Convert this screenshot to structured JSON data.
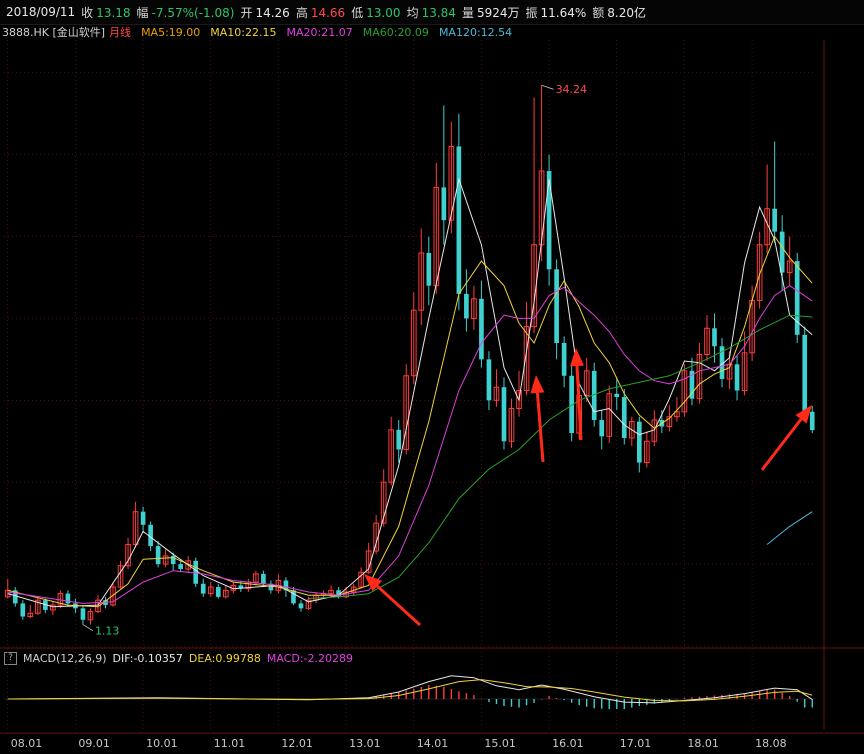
{
  "header": {
    "date": "2018/09/11",
    "close_label": "收",
    "close": "13.18",
    "change_label": "幅",
    "change": "-7.57%(-1.08)",
    "open_label": "开",
    "open": "14.26",
    "high_label": "高",
    "high": "14.66",
    "low_label": "低",
    "low": "13.00",
    "avg_label": "均",
    "avg": "13.84",
    "volume_label": "量",
    "volume": "5924万",
    "amplitude_label": "振",
    "amplitude": "11.64%",
    "amount_label": "额",
    "amount": "8.20亿"
  },
  "ma_legend": {
    "code": "3888.HK [金山软件]",
    "period": "月线",
    "ma5": "MA5:19.00",
    "ma10": "MA10:22.15",
    "ma20": "MA20:21.07",
    "ma60": "MA60:20.09",
    "ma120": "MA120:12.54"
  },
  "macd_legend": {
    "help": "?",
    "name": "MACD(12,26,9)",
    "dif": "DIF:-0.10357",
    "dea": "DEA:0.99788",
    "macd": "MACD:-2.20289"
  },
  "annotations": {
    "high_label": "34.24",
    "low_label": "1.13"
  },
  "colors": {
    "up": "#ff3b3b",
    "down": "#3fd0d0",
    "ma5": "#e8e8e8",
    "ma10": "#f0d23a",
    "ma20": "#e040e0",
    "ma60": "#2ca02c",
    "ma120": "#4fb8d8",
    "arrow": "#ff2a1a",
    "grid": "#7a1414"
  },
  "chart_data": {
    "type": "candlestick",
    "x_ticks": [
      "08.01",
      "09.01",
      "10.01",
      "11.01",
      "12.01",
      "13.01",
      "14.01",
      "15.01",
      "16.01",
      "17.01",
      "18.01",
      "18.08"
    ],
    "price_range": [
      0,
      37
    ],
    "candles": [
      [
        3.0,
        3.4,
        4.1,
        2.9
      ],
      [
        3.4,
        2.6,
        3.6,
        2.4
      ],
      [
        2.6,
        1.8,
        2.8,
        1.6
      ],
      [
        1.8,
        2.0,
        2.5,
        1.7
      ],
      [
        2.0,
        2.8,
        3.0,
        1.9
      ],
      [
        2.8,
        2.2,
        2.9,
        2.0
      ],
      [
        2.2,
        2.5,
        2.7,
        1.9
      ],
      [
        2.5,
        3.2,
        3.4,
        2.3
      ],
      [
        3.2,
        2.6,
        3.4,
        2.4
      ],
      [
        2.6,
        2.3,
        2.9,
        2.0
      ],
      [
        2.3,
        1.6,
        2.5,
        1.3
      ],
      [
        1.6,
        2.1,
        2.3,
        1.3
      ],
      [
        2.1,
        2.8,
        3.1,
        2.0
      ],
      [
        2.8,
        2.5,
        3.0,
        2.3
      ],
      [
        2.5,
        3.6,
        3.9,
        2.4
      ],
      [
        3.6,
        4.9,
        5.2,
        3.5
      ],
      [
        4.9,
        6.2,
        6.6,
        4.7
      ],
      [
        6.2,
        8.2,
        8.8,
        6.0
      ],
      [
        8.2,
        7.4,
        8.5,
        6.9
      ],
      [
        7.4,
        6.1,
        7.6,
        5.8
      ],
      [
        6.1,
        5.0,
        6.4,
        4.8
      ],
      [
        5.0,
        5.5,
        5.9,
        4.8
      ],
      [
        5.5,
        5.0,
        5.7,
        4.6
      ],
      [
        5.0,
        4.7,
        5.3,
        4.5
      ],
      [
        4.7,
        5.2,
        5.5,
        4.5
      ],
      [
        5.2,
        3.8,
        5.4,
        3.6
      ],
      [
        3.8,
        3.2,
        4.1,
        3.0
      ],
      [
        3.2,
        3.6,
        3.9,
        3.0
      ],
      [
        3.6,
        3.0,
        3.8,
        2.9
      ],
      [
        3.0,
        3.4,
        3.7,
        2.9
      ],
      [
        3.4,
        3.7,
        3.9,
        3.2
      ],
      [
        3.7,
        3.5,
        4.0,
        3.3
      ],
      [
        3.5,
        3.9,
        4.1,
        3.3
      ],
      [
        3.9,
        4.4,
        4.6,
        3.7
      ],
      [
        4.4,
        3.8,
        4.6,
        3.6
      ],
      [
        3.8,
        3.4,
        4.0,
        3.2
      ],
      [
        3.4,
        4.0,
        4.4,
        3.2
      ],
      [
        4.0,
        3.4,
        4.2,
        3.0
      ],
      [
        3.4,
        2.6,
        3.6,
        2.5
      ],
      [
        2.6,
        2.3,
        2.8,
        2.1
      ],
      [
        2.3,
        2.8,
        3.0,
        2.2
      ],
      [
        2.8,
        3.1,
        3.3,
        2.6
      ],
      [
        3.1,
        3.2,
        3.4,
        2.9
      ],
      [
        3.2,
        3.4,
        3.7,
        3.0
      ],
      [
        3.4,
        3.0,
        3.6,
        2.9
      ],
      [
        3.0,
        3.3,
        3.6,
        2.9
      ],
      [
        3.3,
        3.6,
        3.8,
        3.1
      ],
      [
        3.6,
        4.5,
        4.8,
        3.5
      ],
      [
        4.5,
        5.8,
        6.3,
        4.4
      ],
      [
        5.8,
        7.5,
        8.0,
        5.6
      ],
      [
        7.5,
        10.0,
        10.8,
        7.3
      ],
      [
        10.0,
        13.2,
        14.0,
        9.8
      ],
      [
        13.2,
        12.0,
        13.8,
        11.2
      ],
      [
        12.0,
        16.5,
        17.2,
        11.7
      ],
      [
        16.5,
        20.5,
        21.6,
        16.0
      ],
      [
        20.5,
        24.0,
        25.5,
        19.6
      ],
      [
        24.0,
        22.0,
        25.0,
        20.8
      ],
      [
        22.0,
        28.0,
        29.5,
        21.5
      ],
      [
        28.0,
        26.0,
        33.0,
        24.5
      ],
      [
        26.0,
        30.5,
        32.0,
        25.2
      ],
      [
        30.5,
        21.5,
        32.5,
        20.5
      ],
      [
        21.5,
        20.0,
        23.0,
        19.2
      ],
      [
        20.0,
        21.2,
        22.0,
        19.3
      ],
      [
        21.2,
        17.5,
        22.3,
        17.0
      ],
      [
        17.5,
        15.0,
        18.0,
        14.4
      ],
      [
        15.0,
        15.8,
        16.9,
        14.6
      ],
      [
        15.8,
        12.5,
        16.4,
        12.0
      ],
      [
        12.5,
        14.5,
        15.1,
        12.1
      ],
      [
        14.5,
        15.6,
        16.8,
        14.0
      ],
      [
        15.6,
        19.5,
        21.0,
        15.3
      ],
      [
        19.5,
        24.5,
        33.5,
        19.1
      ],
      [
        24.5,
        29.0,
        34.24,
        23.5
      ],
      [
        29.0,
        23.0,
        30.0,
        22.0
      ],
      [
        23.0,
        18.5,
        23.6,
        17.5
      ],
      [
        18.5,
        16.5,
        18.9,
        15.8
      ],
      [
        16.5,
        13.0,
        17.2,
        12.5
      ],
      [
        13.0,
        15.3,
        15.8,
        12.6
      ],
      [
        15.3,
        16.8,
        17.6,
        14.9
      ],
      [
        16.8,
        13.8,
        17.3,
        13.4
      ],
      [
        13.8,
        12.8,
        14.4,
        12.0
      ],
      [
        12.8,
        15.4,
        15.9,
        12.4
      ],
      [
        15.4,
        15.2,
        16.4,
        14.4
      ],
      [
        15.2,
        12.7,
        15.7,
        12.3
      ],
      [
        12.7,
        13.7,
        14.0,
        12.2
      ],
      [
        13.7,
        11.2,
        14.0,
        10.6
      ],
      [
        11.2,
        12.5,
        13.1,
        10.9
      ],
      [
        12.5,
        13.8,
        14.4,
        12.2
      ],
      [
        13.8,
        13.4,
        14.4,
        13.0
      ],
      [
        13.4,
        14.0,
        14.7,
        13.1
      ],
      [
        14.0,
        14.3,
        15.2,
        13.7
      ],
      [
        14.3,
        16.8,
        17.2,
        14.0
      ],
      [
        16.8,
        15.1,
        17.6,
        14.7
      ],
      [
        15.1,
        17.8,
        18.5,
        14.8
      ],
      [
        17.8,
        19.4,
        20.2,
        17.4
      ],
      [
        19.4,
        18.3,
        20.3,
        17.3
      ],
      [
        18.3,
        16.3,
        18.8,
        15.8
      ],
      [
        16.3,
        17.2,
        18.0,
        15.7
      ],
      [
        17.2,
        15.6,
        17.7,
        15.0
      ],
      [
        15.6,
        17.9,
        19.2,
        15.3
      ],
      [
        17.9,
        21.1,
        22.0,
        17.4
      ],
      [
        21.1,
        24.5,
        25.3,
        20.6
      ],
      [
        24.5,
        26.7,
        29.4,
        24.0
      ],
      [
        26.7,
        25.3,
        30.8,
        24.6
      ],
      [
        25.3,
        22.8,
        26.3,
        21.7
      ],
      [
        22.8,
        23.5,
        25.0,
        22.0
      ],
      [
        23.5,
        19.0,
        24.0,
        18.5
      ],
      [
        19.0,
        14.3,
        19.5,
        14.0
      ],
      [
        14.3,
        13.18,
        14.66,
        13.0
      ]
    ],
    "ma_series": {
      "MA5": [
        [
          0,
          3.2
        ],
        [
          6,
          2.4
        ],
        [
          12,
          2.5
        ],
        [
          16,
          5.2
        ],
        [
          18,
          7.0
        ],
        [
          22,
          5.6
        ],
        [
          26,
          4.3
        ],
        [
          30,
          3.5
        ],
        [
          36,
          3.7
        ],
        [
          40,
          2.7
        ],
        [
          44,
          3.1
        ],
        [
          48,
          4.7
        ],
        [
          52,
          11.0
        ],
        [
          56,
          20.0
        ],
        [
          60,
          28.5
        ],
        [
          63,
          24.5
        ],
        [
          66,
          17.0
        ],
        [
          68,
          15.0
        ],
        [
          70,
          21.0
        ],
        [
          72,
          28.5
        ],
        [
          74,
          22.5
        ],
        [
          76,
          16.0
        ],
        [
          78,
          14.3
        ],
        [
          80,
          14.5
        ],
        [
          82,
          13.5
        ],
        [
          84,
          12.9
        ],
        [
          86,
          13.2
        ],
        [
          88,
          15.1
        ],
        [
          90,
          17.4
        ],
        [
          92,
          17.3
        ],
        [
          94,
          16.8
        ],
        [
          96,
          17.6
        ],
        [
          98,
          23.4
        ],
        [
          100,
          26.8
        ],
        [
          102,
          24.8
        ],
        [
          104,
          20.2
        ],
        [
          107,
          19.0
        ]
      ],
      "MA10": [
        [
          0,
          3.4
        ],
        [
          8,
          2.5
        ],
        [
          12,
          2.4
        ],
        [
          16,
          3.8
        ],
        [
          18,
          5.3
        ],
        [
          22,
          5.4
        ],
        [
          26,
          4.6
        ],
        [
          30,
          3.9
        ],
        [
          36,
          3.6
        ],
        [
          40,
          3.1
        ],
        [
          44,
          3.1
        ],
        [
          48,
          3.7
        ],
        [
          52,
          7.3
        ],
        [
          56,
          13.7
        ],
        [
          60,
          21.5
        ],
        [
          63,
          23.5
        ],
        [
          66,
          22.0
        ],
        [
          68,
          19.7
        ],
        [
          70,
          18.5
        ],
        [
          72,
          20.8
        ],
        [
          74,
          22.3
        ],
        [
          76,
          20.7
        ],
        [
          78,
          18.5
        ],
        [
          80,
          17.3
        ],
        [
          82,
          15.4
        ],
        [
          84,
          14.1
        ],
        [
          86,
          13.3
        ],
        [
          88,
          13.9
        ],
        [
          90,
          14.9
        ],
        [
          92,
          16.0
        ],
        [
          94,
          16.6
        ],
        [
          96,
          17.0
        ],
        [
          98,
          19.5
        ],
        [
          100,
          22.7
        ],
        [
          102,
          25.0
        ],
        [
          104,
          23.7
        ],
        [
          107,
          22.15
        ]
      ],
      "MA20": [
        [
          0,
          3.3
        ],
        [
          10,
          2.6
        ],
        [
          14,
          2.7
        ],
        [
          18,
          3.9
        ],
        [
          22,
          4.6
        ],
        [
          26,
          4.4
        ],
        [
          30,
          4.0
        ],
        [
          36,
          3.7
        ],
        [
          40,
          3.3
        ],
        [
          44,
          3.1
        ],
        [
          48,
          3.4
        ],
        [
          52,
          5.5
        ],
        [
          56,
          9.8
        ],
        [
          60,
          15.6
        ],
        [
          63,
          18.5
        ],
        [
          66,
          20.2
        ],
        [
          68,
          20.0
        ],
        [
          70,
          20.0
        ],
        [
          72,
          21.4
        ],
        [
          74,
          21.9
        ],
        [
          76,
          21.0
        ],
        [
          78,
          20.2
        ],
        [
          80,
          19.2
        ],
        [
          82,
          17.8
        ],
        [
          84,
          16.8
        ],
        [
          86,
          16.2
        ],
        [
          88,
          16.0
        ],
        [
          90,
          16.3
        ],
        [
          92,
          16.8
        ],
        [
          94,
          17.0
        ],
        [
          96,
          17.2
        ],
        [
          98,
          18.3
        ],
        [
          100,
          20.0
        ],
        [
          102,
          21.4
        ],
        [
          104,
          22.0
        ],
        [
          107,
          21.07
        ]
      ],
      "MA60": [
        [
          40,
          2.9
        ],
        [
          44,
          3.0
        ],
        [
          48,
          3.2
        ],
        [
          52,
          4.2
        ],
        [
          56,
          6.3
        ],
        [
          60,
          9.0
        ],
        [
          64,
          10.8
        ],
        [
          68,
          12.0
        ],
        [
          72,
          13.8
        ],
        [
          76,
          15.0
        ],
        [
          80,
          15.7
        ],
        [
          84,
          16.1
        ],
        [
          88,
          16.5
        ],
        [
          92,
          17.3
        ],
        [
          96,
          18.2
        ],
        [
          100,
          19.3
        ],
        [
          104,
          20.2
        ],
        [
          107,
          20.09
        ]
      ],
      "MA120": [
        [
          101,
          6.2
        ],
        [
          104,
          7.3
        ],
        [
          107,
          8.2
        ]
      ]
    },
    "macd": {
      "range": [
        -8,
        8
      ],
      "dif": [
        [
          0,
          0.0
        ],
        [
          20,
          0.3
        ],
        [
          40,
          -0.2
        ],
        [
          48,
          0.3
        ],
        [
          52,
          1.8
        ],
        [
          56,
          4.5
        ],
        [
          59,
          6.0
        ],
        [
          62,
          5.5
        ],
        [
          65,
          3.4
        ],
        [
          68,
          2.4
        ],
        [
          71,
          3.6
        ],
        [
          74,
          2.5
        ],
        [
          78,
          0.6
        ],
        [
          82,
          -0.8
        ],
        [
          86,
          -1.0
        ],
        [
          90,
          -0.4
        ],
        [
          94,
          0.3
        ],
        [
          98,
          1.4
        ],
        [
          102,
          2.8
        ],
        [
          105,
          2.4
        ],
        [
          107,
          -0.10357
        ]
      ],
      "dea": [
        [
          0,
          0.0
        ],
        [
          20,
          0.2
        ],
        [
          40,
          -0.1
        ],
        [
          48,
          0.1
        ],
        [
          52,
          0.9
        ],
        [
          56,
          2.6
        ],
        [
          60,
          4.5
        ],
        [
          63,
          5.0
        ],
        [
          66,
          4.2
        ],
        [
          69,
          3.2
        ],
        [
          72,
          3.1
        ],
        [
          75,
          2.7
        ],
        [
          78,
          1.8
        ],
        [
          82,
          0.5
        ],
        [
          86,
          -0.4
        ],
        [
          90,
          -0.5
        ],
        [
          94,
          -0.1
        ],
        [
          98,
          0.7
        ],
        [
          102,
          1.7
        ],
        [
          105,
          2.0
        ],
        [
          107,
          0.99788
        ]
      ],
      "hist": [
        [
          48,
          0.4
        ],
        [
          50,
          1.2
        ],
        [
          52,
          1.8
        ],
        [
          54,
          2.6
        ],
        [
          56,
          3.6
        ],
        [
          58,
          3.2
        ],
        [
          60,
          2.0
        ],
        [
          62,
          1.0
        ],
        [
          64,
          -0.8
        ],
        [
          66,
          -1.8
        ],
        [
          68,
          -2.2
        ],
        [
          70,
          -1.0
        ],
        [
          72,
          0.8
        ],
        [
          74,
          -0.3
        ],
        [
          76,
          -1.6
        ],
        [
          78,
          -2.4
        ],
        [
          80,
          -2.6
        ],
        [
          82,
          -2.6
        ],
        [
          84,
          -1.8
        ],
        [
          86,
          -1.2
        ],
        [
          88,
          -0.5
        ],
        [
          90,
          0.3
        ],
        [
          92,
          0.6
        ],
        [
          94,
          0.9
        ],
        [
          96,
          1.2
        ],
        [
          98,
          1.4
        ],
        [
          100,
          2.2
        ],
        [
          102,
          2.4
        ],
        [
          104,
          0.8
        ],
        [
          106,
          -2.2
        ],
        [
          107,
          -2.20289
        ]
      ]
    }
  }
}
